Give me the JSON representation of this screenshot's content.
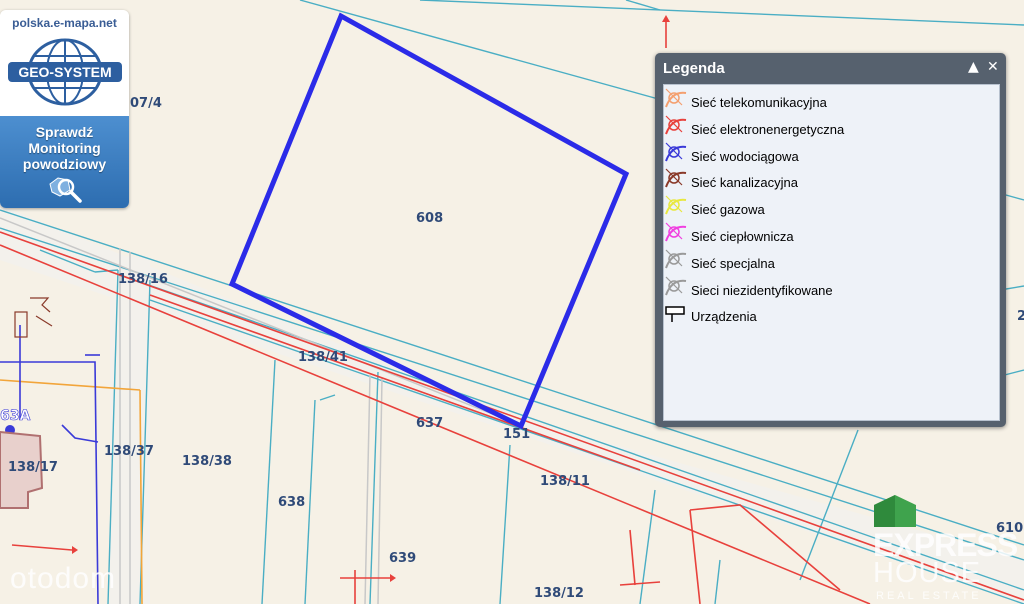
{
  "brand": {
    "site": "polska.e-mapa.net",
    "logo_text": "GEO-SYSTEM",
    "cta": "Sprawdź\nMonitoring\npowodziowy",
    "cta_icon": "magnifier-globe-icon"
  },
  "legend": {
    "title": "Legenda",
    "collapse_icon": "▲",
    "close_icon": "✕",
    "items": [
      {
        "label": "Sieć telekomunikacyjna",
        "color": "#f4a070",
        "icon": "network-line-icon"
      },
      {
        "label": "Sieć elektronenergetyczna",
        "color": "#e8413c",
        "icon": "network-line-icon"
      },
      {
        "label": "Sieć wodociągowa",
        "color": "#3a3ad8",
        "icon": "network-line-icon"
      },
      {
        "label": "Sieć kanalizacyjna",
        "color": "#8a3a2a",
        "icon": "network-line-icon"
      },
      {
        "label": "Sieć gazowa",
        "color": "#e8e840",
        "icon": "network-line-icon"
      },
      {
        "label": "Sieć ciepłownicza",
        "color": "#f040e0",
        "icon": "network-line-icon"
      },
      {
        "label": "Sieć specjalna",
        "color": "#9a9a9a",
        "icon": "network-line-icon"
      },
      {
        "label": "Sieci niezidentyfikowane",
        "color": "#9a9a9a",
        "icon": "network-line-icon"
      },
      {
        "label": "Urządzenia",
        "color": "#000000",
        "icon": "device-sign-icon"
      }
    ]
  },
  "parcels": {
    "p607_4": "07/4",
    "p608": "608",
    "p138_16": "138/16",
    "p138_41": "138/41",
    "p637": "637",
    "p151": "151",
    "p138_37": "138/37",
    "p138_38": "138/38",
    "p138_17": "138/17",
    "p638": "638",
    "p639": "639",
    "p138_11": "138/11",
    "p138_12": "138/12",
    "p610": "610",
    "p2": "2",
    "addr": "63A"
  },
  "watermarks": {
    "otodom": "otodom",
    "express1": "EXPRESS",
    "express2": "HOUSE",
    "express3": "REAL ESTATE"
  },
  "colors": {
    "background": "#f6f1e6",
    "parcel_border": "#4aaec4",
    "selected_parcel": "#2b2be8",
    "power_line": "#e8413c",
    "water_line": "#3a3ad8",
    "gas_line": "#f2a53a",
    "building": "#e8d0cc"
  }
}
